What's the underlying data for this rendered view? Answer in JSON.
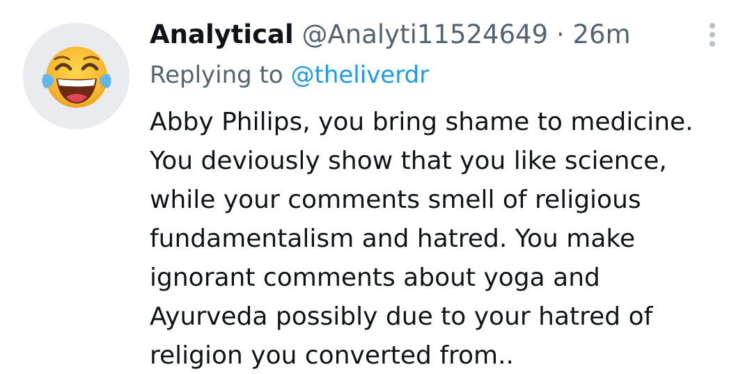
{
  "tweet": {
    "author": {
      "display_name": "Analytical",
      "handle": "@Analyti11524649",
      "separator": "·",
      "time": "26m",
      "avatar_icon": "face-with-tears-of-joy-emoji-icon"
    },
    "reply": {
      "prefix": "Replying to",
      "target": "@theliverdr"
    },
    "text_lines": [
      "Abby Philips, you bring shame to medicine.",
      "You deviously show that you like science,",
      "while your comments smell of religious",
      "fundamentalism and hatred. You make",
      "ignorant comments about yoga and",
      "Ayurveda possibly due to your hatred of",
      "religion you converted from.."
    ],
    "more_icon": "more-options-vertical-icon"
  },
  "colors": {
    "text_primary": "#0f1419",
    "text_secondary": "#536471",
    "link": "#1d9bf0",
    "avatar_bg": "#e9ebee",
    "more_dots": "#b7c0c8"
  }
}
